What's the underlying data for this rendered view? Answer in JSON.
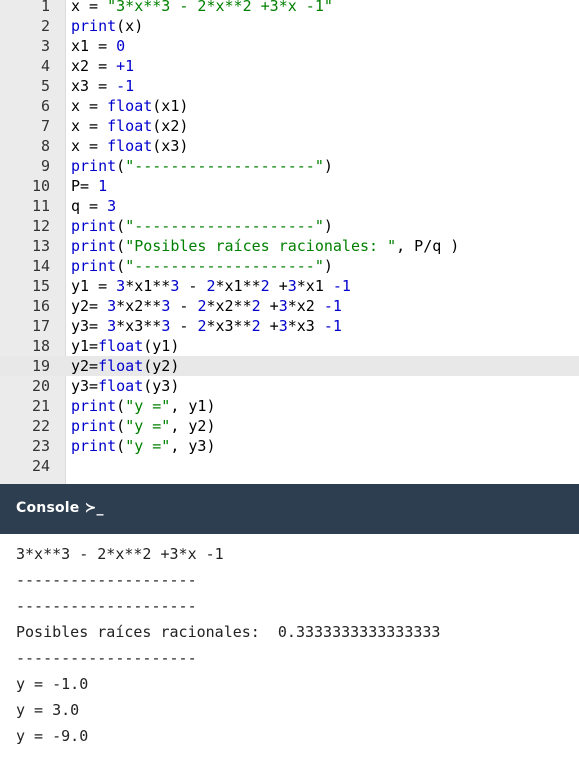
{
  "editor": {
    "active_line": 19,
    "lines": [
      {
        "num": "1",
        "tokens": [
          {
            "t": "x = ",
            "c": "id"
          },
          {
            "t": "\"3*x**3 - 2*x**2 +3*x -1\"",
            "c": "str"
          }
        ]
      },
      {
        "num": "2",
        "tokens": [
          {
            "t": "print",
            "c": "kw"
          },
          {
            "t": "(x)",
            "c": "id"
          }
        ]
      },
      {
        "num": "3",
        "tokens": [
          {
            "t": "x1 = ",
            "c": "id"
          },
          {
            "t": "0",
            "c": "num"
          }
        ]
      },
      {
        "num": "4",
        "tokens": [
          {
            "t": "x2 = ",
            "c": "id"
          },
          {
            "t": "+1",
            "c": "num"
          }
        ]
      },
      {
        "num": "5",
        "tokens": [
          {
            "t": "x3 = ",
            "c": "id"
          },
          {
            "t": "-1",
            "c": "num"
          }
        ]
      },
      {
        "num": "6",
        "tokens": [
          {
            "t": "x = ",
            "c": "id"
          },
          {
            "t": "float",
            "c": "kw"
          },
          {
            "t": "(x1)",
            "c": "id"
          }
        ]
      },
      {
        "num": "7",
        "tokens": [
          {
            "t": "x = ",
            "c": "id"
          },
          {
            "t": "float",
            "c": "kw"
          },
          {
            "t": "(x2)",
            "c": "id"
          }
        ]
      },
      {
        "num": "8",
        "tokens": [
          {
            "t": "x = ",
            "c": "id"
          },
          {
            "t": "float",
            "c": "kw"
          },
          {
            "t": "(x3)",
            "c": "id"
          }
        ]
      },
      {
        "num": "9",
        "tokens": [
          {
            "t": "print",
            "c": "kw"
          },
          {
            "t": "(",
            "c": "id"
          },
          {
            "t": "\"--------------------\"",
            "c": "str"
          },
          {
            "t": ")",
            "c": "id"
          }
        ]
      },
      {
        "num": "10",
        "tokens": [
          {
            "t": "P= ",
            "c": "id"
          },
          {
            "t": "1",
            "c": "num"
          }
        ]
      },
      {
        "num": "11",
        "tokens": [
          {
            "t": "q = ",
            "c": "id"
          },
          {
            "t": "3",
            "c": "num"
          }
        ]
      },
      {
        "num": "12",
        "tokens": [
          {
            "t": "print",
            "c": "kw"
          },
          {
            "t": "(",
            "c": "id"
          },
          {
            "t": "\"--------------------\"",
            "c": "str"
          },
          {
            "t": ")",
            "c": "id"
          }
        ]
      },
      {
        "num": "13",
        "tokens": [
          {
            "t": "print",
            "c": "kw"
          },
          {
            "t": "(",
            "c": "id"
          },
          {
            "t": "\"Posibles raíces racionales: \"",
            "c": "str"
          },
          {
            "t": ", P/q )",
            "c": "id"
          }
        ]
      },
      {
        "num": "14",
        "tokens": [
          {
            "t": "print",
            "c": "kw"
          },
          {
            "t": "(",
            "c": "id"
          },
          {
            "t": "\"--------------------\"",
            "c": "str"
          },
          {
            "t": ")",
            "c": "id"
          }
        ]
      },
      {
        "num": "15",
        "tokens": [
          {
            "t": "y1 = ",
            "c": "id"
          },
          {
            "t": "3",
            "c": "num"
          },
          {
            "t": "*x1**",
            "c": "id"
          },
          {
            "t": "3",
            "c": "num"
          },
          {
            "t": " - ",
            "c": "id"
          },
          {
            "t": "2",
            "c": "num"
          },
          {
            "t": "*x1**",
            "c": "id"
          },
          {
            "t": "2",
            "c": "num"
          },
          {
            "t": " +",
            "c": "id"
          },
          {
            "t": "3",
            "c": "num"
          },
          {
            "t": "*x1 ",
            "c": "id"
          },
          {
            "t": "-1",
            "c": "num"
          }
        ]
      },
      {
        "num": "16",
        "tokens": [
          {
            "t": "y2= ",
            "c": "id"
          },
          {
            "t": "3",
            "c": "num"
          },
          {
            "t": "*x2**",
            "c": "id"
          },
          {
            "t": "3",
            "c": "num"
          },
          {
            "t": " - ",
            "c": "id"
          },
          {
            "t": "2",
            "c": "num"
          },
          {
            "t": "*x2**",
            "c": "id"
          },
          {
            "t": "2",
            "c": "num"
          },
          {
            "t": " +",
            "c": "id"
          },
          {
            "t": "3",
            "c": "num"
          },
          {
            "t": "*x2 ",
            "c": "id"
          },
          {
            "t": "-1",
            "c": "num"
          }
        ]
      },
      {
        "num": "17",
        "tokens": [
          {
            "t": "y3= ",
            "c": "id"
          },
          {
            "t": "3",
            "c": "num"
          },
          {
            "t": "*x3**",
            "c": "id"
          },
          {
            "t": "3",
            "c": "num"
          },
          {
            "t": " - ",
            "c": "id"
          },
          {
            "t": "2",
            "c": "num"
          },
          {
            "t": "*x3**",
            "c": "id"
          },
          {
            "t": "2",
            "c": "num"
          },
          {
            "t": " +",
            "c": "id"
          },
          {
            "t": "3",
            "c": "num"
          },
          {
            "t": "*x3 ",
            "c": "id"
          },
          {
            "t": "-1",
            "c": "num"
          }
        ]
      },
      {
        "num": "18",
        "tokens": [
          {
            "t": "y1=",
            "c": "id"
          },
          {
            "t": "float",
            "c": "kw"
          },
          {
            "t": "(y1)",
            "c": "id"
          }
        ]
      },
      {
        "num": "19",
        "tokens": [
          {
            "t": "y2=",
            "c": "id"
          },
          {
            "t": "float",
            "c": "kw"
          },
          {
            "t": "(y2)",
            "c": "id"
          }
        ]
      },
      {
        "num": "20",
        "tokens": [
          {
            "t": "y3=",
            "c": "id"
          },
          {
            "t": "float",
            "c": "kw"
          },
          {
            "t": "(y3)",
            "c": "id"
          }
        ]
      },
      {
        "num": "21",
        "tokens": [
          {
            "t": "print",
            "c": "kw"
          },
          {
            "t": "(",
            "c": "id"
          },
          {
            "t": "\"y =\"",
            "c": "str"
          },
          {
            "t": ", y1)",
            "c": "id"
          }
        ]
      },
      {
        "num": "22",
        "tokens": [
          {
            "t": "print",
            "c": "kw"
          },
          {
            "t": "(",
            "c": "id"
          },
          {
            "t": "\"y =\"",
            "c": "str"
          },
          {
            "t": ", y2)",
            "c": "id"
          }
        ]
      },
      {
        "num": "23",
        "tokens": [
          {
            "t": "print",
            "c": "kw"
          },
          {
            "t": "(",
            "c": "id"
          },
          {
            "t": "\"y =\"",
            "c": "str"
          },
          {
            "t": ", y3)",
            "c": "id"
          }
        ]
      },
      {
        "num": "24",
        "tokens": []
      }
    ]
  },
  "console": {
    "title": "Console ≻_",
    "output": [
      "3*x**3 - 2*x**2 +3*x -1",
      "--------------------",
      "--------------------",
      "Posibles raíces racionales:  0.3333333333333333",
      "--------------------",
      "y = -1.0",
      "y = 3.0",
      "y = -9.0"
    ]
  },
  "colors": {
    "keyword": "#0000cd",
    "string": "#008000",
    "console_header": "#2d3e50",
    "gutter": "#ebebeb"
  }
}
